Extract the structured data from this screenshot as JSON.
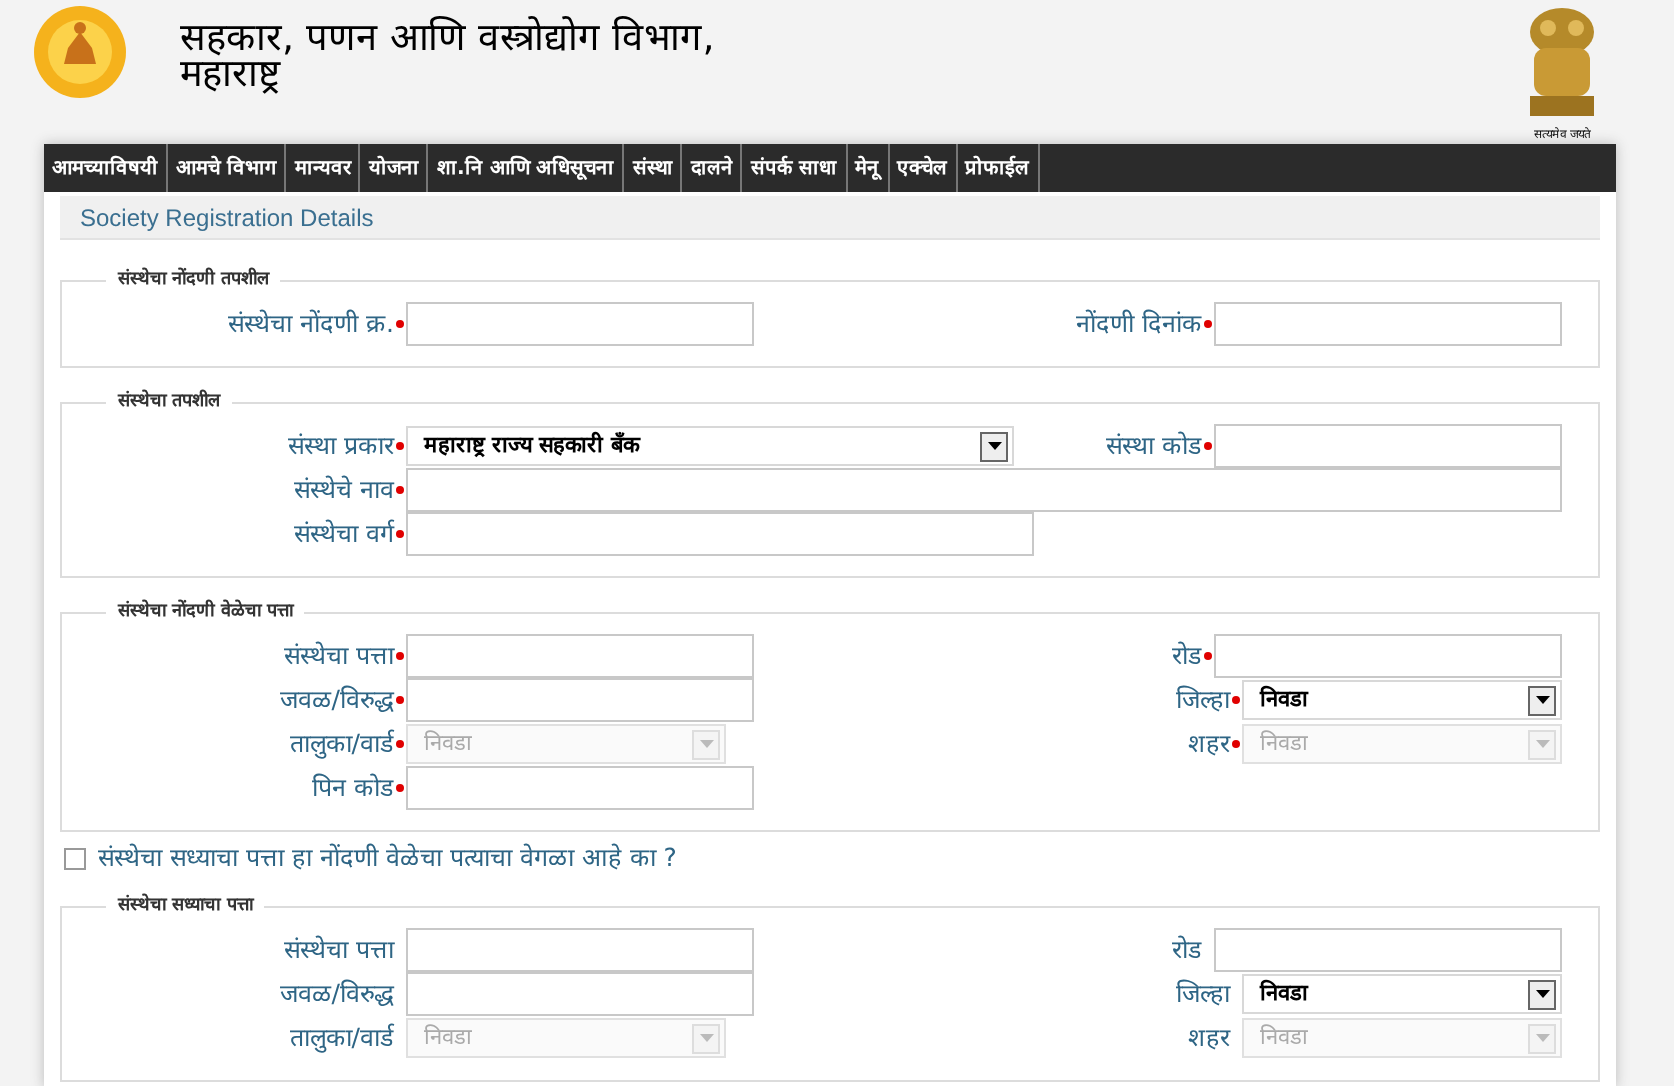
{
  "header": {
    "title_lines": [
      "सहकार, पणन आणि वस्त्रोद्योग विभाग,",
      "महाराष्ट्र"
    ],
    "emblem_caption": "सत्यमेव जयते"
  },
  "nav": [
    {
      "label": "आमच्याविषयी"
    },
    {
      "label": "आमचे विभाग"
    },
    {
      "label": "मान्यवर"
    },
    {
      "label": "योजना"
    },
    {
      "label": "शा.नि आणि अधिसूचना"
    },
    {
      "label": "संस्था"
    },
    {
      "label": "दालने"
    },
    {
      "label": "संपर्क साधा"
    },
    {
      "label": "मेनू"
    },
    {
      "label": "एक्चेल"
    },
    {
      "label": "प्रोफाईल"
    }
  ],
  "page_title": "Society Registration Details",
  "content": [
    {
      "kind": "section",
      "legend": "संस्थेचा नोंदणी तपशील",
      "rows": [
        {
          "left": {
            "label": "संस्थेचा नोंदणी क्र.",
            "required": true,
            "kind": "text"
          },
          "right": {
            "label": "नोंदणी दिनांक",
            "required": true,
            "kind": "text"
          }
        }
      ]
    },
    {
      "kind": "section",
      "legend": "संस्थेचा तपशील",
      "rows": [
        {
          "left": {
            "label": "संस्था प्रकार",
            "required": true,
            "kind": "select",
            "value": "महाराष्ट्र राज्य सहकारी बँक",
            "disabled": false
          },
          "right": {
            "label": "संस्था कोड",
            "required": true,
            "kind": "text"
          }
        },
        {
          "left": {
            "label": "संस्थेचे नाव",
            "required": true,
            "kind": "text",
            "wide": true
          }
        },
        {
          "left": {
            "label": "संस्थेचा वर्ग",
            "required": true,
            "kind": "text"
          }
        }
      ]
    },
    {
      "kind": "section",
      "legend": "संस्थेचा नोंदणी वेळेचा पत्ता",
      "rows": [
        {
          "left": {
            "label": "संस्थेचा पत्ता",
            "required": true,
            "kind": "text"
          },
          "right": {
            "label": "रोड",
            "required": true,
            "kind": "text"
          }
        },
        {
          "left": {
            "label": "जवळ/विरुद्ध",
            "required": true,
            "kind": "text"
          },
          "right": {
            "label": "जिल्हा",
            "required": true,
            "kind": "select",
            "value": "निवडा",
            "disabled": false
          }
        },
        {
          "left": {
            "label": "तालुका/वार्ड",
            "required": true,
            "kind": "select",
            "value": "निवडा",
            "disabled": true
          },
          "right": {
            "label": "शहर",
            "required": true,
            "kind": "select",
            "value": "निवडा",
            "disabled": true
          }
        },
        {
          "left": {
            "label": "पिन कोड",
            "required": true,
            "kind": "text"
          }
        }
      ]
    },
    {
      "kind": "checkbox",
      "label": "संस्थेचा सध्याचा पत्ता हा नोंदणी वेळेचा पत्याचा वेगळा आहे का ?",
      "checked": false
    },
    {
      "kind": "section",
      "legend": "संस्थेचा सध्याचा पत्ता",
      "rows": [
        {
          "left": {
            "label": "संस्थेचा पत्ता",
            "required": false,
            "kind": "text"
          },
          "right": {
            "label": "रोड",
            "required": false,
            "kind": "text"
          }
        },
        {
          "left": {
            "label": "जवळ/विरुद्ध",
            "required": false,
            "kind": "text"
          },
          "right": {
            "label": "जिल्हा",
            "required": false,
            "kind": "select",
            "value": "निवडा",
            "disabled": false
          }
        },
        {
          "left": {
            "label": "तालुका/वार्ड",
            "required": false,
            "kind": "select",
            "value": "निवडा",
            "disabled": true
          },
          "right": {
            "label": "शहर",
            "required": false,
            "kind": "select",
            "value": "निवडा",
            "disabled": true
          }
        }
      ]
    }
  ]
}
